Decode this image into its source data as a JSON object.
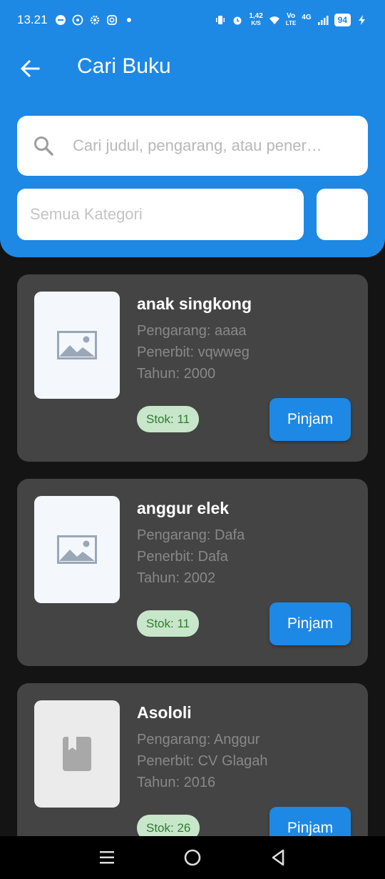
{
  "status_bar": {
    "time": "13.21",
    "net_speed_value": "1,42",
    "net_speed_unit": "K/S",
    "volte_top": "Vo",
    "volte_bottom": "LTE",
    "network": "4G",
    "battery": "94"
  },
  "header": {
    "title": "Cari Buku",
    "search_placeholder": "Cari judul, pengarang, atau pener…",
    "category_value": "Semua Kategori"
  },
  "books": [
    {
      "title": "anak singkong",
      "author": "Pengarang: aaaa",
      "publisher": "Penerbit: vqwweg",
      "year": "Tahun: 2000",
      "stock": "Stok: 11",
      "action": "Pinjam",
      "cover_icon": "image-placeholder-icon"
    },
    {
      "title": "anggur elek",
      "author": "Pengarang: Dafa",
      "publisher": "Penerbit: Dafa",
      "year": "Tahun: 2002",
      "stock": "Stok: 11",
      "action": "Pinjam",
      "cover_icon": "image-placeholder-icon"
    },
    {
      "title": "Asololi",
      "author": "Pengarang: Anggur",
      "publisher": "Penerbit: CV Glagah",
      "year": "Tahun: 2016",
      "stock": "Stok: 26",
      "action": "Pinjam",
      "cover_icon": "book-icon"
    }
  ],
  "colors": {
    "primary": "#1e88e5",
    "card": "#444444",
    "stock_bg": "#c8e6c9",
    "stock_text": "#2e7d32"
  }
}
